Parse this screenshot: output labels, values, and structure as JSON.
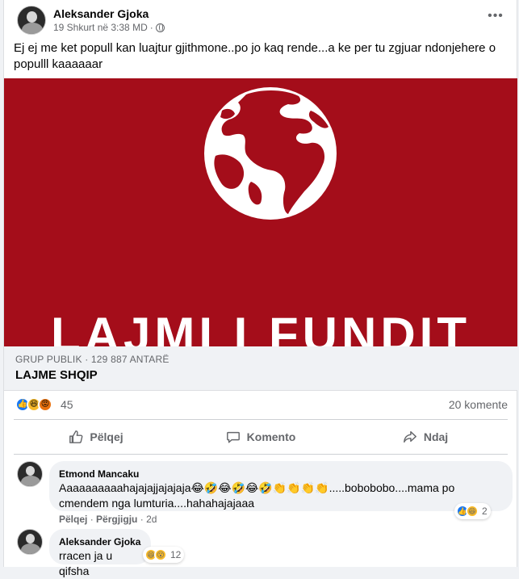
{
  "post": {
    "author": "Aleksander Gjoka",
    "timestamp": "19 Shkurt në 3:38 MD",
    "privacy_icon": "globe-icon",
    "more_label": "•••",
    "text": "Ej ej me ket popull kan luajtur gjithmone..po jo kaq rende...a ke per tu zgjuar ndonjehere o populll kaaaaaar"
  },
  "image": {
    "title": "LAJMI I FUNDIT",
    "background_color": "#a40d1a"
  },
  "group": {
    "meta": "GRUP PUBLIK · 129 887 ANTARË",
    "name": "LAJME SHQIP"
  },
  "stats": {
    "reactions": [
      "like",
      "haha",
      "angry"
    ],
    "reaction_count": "45",
    "comment_count": "20 komente"
  },
  "actions": {
    "like": "Pëlqej",
    "comment": "Komento",
    "share": "Ndaj"
  },
  "comments": [
    {
      "name": "Etmond Mancaku",
      "text": "Aaaaaaaaaahajajajjajajaja😂🤣😂🤣😂🤣👏👏👏👏.....bobobobo....mama po cmendem nga lumturia....hahahajajaaa",
      "like_label": "Pëlqej",
      "reply_label": "Përgjigju",
      "time": "2d",
      "reaction_count": "2"
    },
    {
      "name": "Aleksander Gjoka",
      "text": "rracen ja u qifsha",
      "reaction_count": "12"
    }
  ]
}
